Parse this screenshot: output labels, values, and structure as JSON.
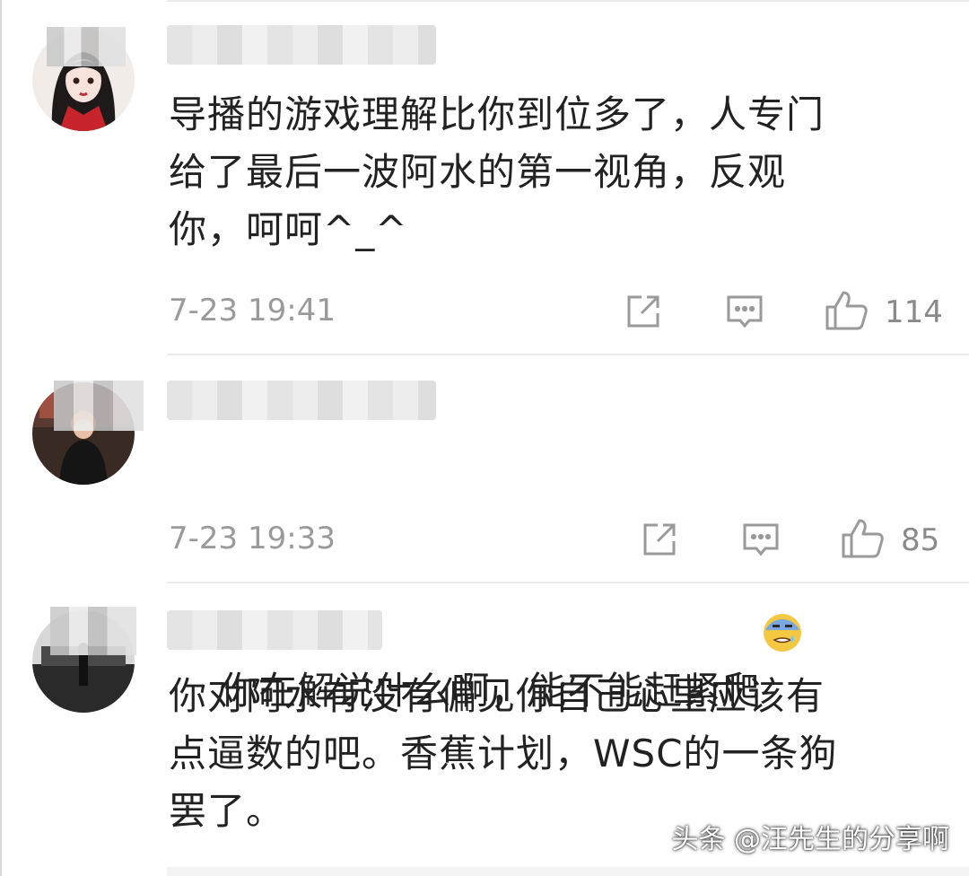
{
  "comments": [
    {
      "text": "导播的游戏理解比你到位多了，人专门\n给了最后一波阿水的第一视角，反观\n你，呵呵^_^",
      "time": "7-23 19:41",
      "likes": "114"
    },
    {
      "text": "你在解说什么啊，能不能赶紧爬",
      "emoji": "cold-sweat-face-emoji",
      "time": "7-23 19:33",
      "likes": "85"
    },
    {
      "text": "你对阿水有没有偏见你自己心里应该有\n点逼数的吧。香蕉计划，WSC的一条狗\n罢了。"
    }
  ],
  "icons": {
    "share": "share-icon",
    "reply": "reply-comment-icon",
    "like": "thumbs-up-icon"
  },
  "watermark": "头条 @汪先生的分享啊",
  "colors": {
    "text": "#222222",
    "meta": "#9a9a9a",
    "icon": "#9a9a9a",
    "divider": "#ececec"
  }
}
